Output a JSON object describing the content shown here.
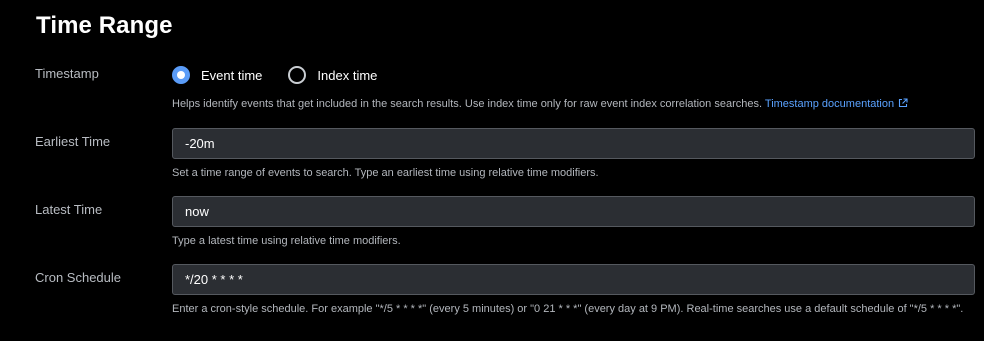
{
  "section": {
    "title": "Time Range"
  },
  "timestamp": {
    "label": "Timestamp",
    "options": [
      {
        "label": "Event time",
        "selected": true
      },
      {
        "label": "Index time",
        "selected": false
      }
    ],
    "help_text": "Helps identify events that get included in the search results. Use index time only for raw event index correlation searches. ",
    "help_link": "Timestamp documentation",
    "help_link_icon": "external-link-icon"
  },
  "earliest_time": {
    "label": "Earliest Time",
    "value": "-20m",
    "help_text": "Set a time range of events to search. Type an earliest time using relative time modifiers."
  },
  "latest_time": {
    "label": "Latest Time",
    "value": "now",
    "help_text": "Type a latest time using relative time modifiers."
  },
  "cron_schedule": {
    "label": "Cron Schedule",
    "value": "*/20 * * * *",
    "help_text": "Enter a cron-style schedule. For example \"*/5 * * * *\" (every 5 minutes) or \"0 21 * * *\" (every day at 9 PM). Real-time searches use a default schedule of \"*/5 * * * *\"."
  },
  "colors": {
    "background": "#000000",
    "input_background": "#2b2e33",
    "accent": "#5a9cf8",
    "link": "#5aa2ff"
  }
}
